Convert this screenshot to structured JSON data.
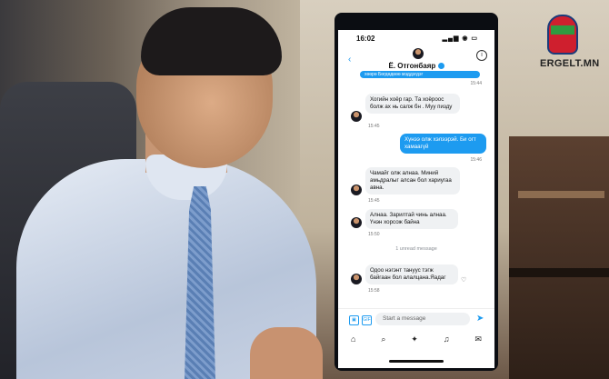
{
  "brand": {
    "name": "ERGELT.MN"
  },
  "status_bar": {
    "time": "16:02",
    "icons": "▂▄▆ ◉ ▭"
  },
  "header": {
    "back": "‹",
    "contact_name": "Ё. Отгонбаяр",
    "info": "i",
    "clipped_line": "хөөрө Бөгдөдөөө мэддэгдэг"
  },
  "messages": [
    {
      "dir": "in",
      "text": "",
      "time": "15:44"
    },
    {
      "dir": "in",
      "text": "Хогийн хоёр гар. Та хоёроос болж ах нь салж бн . Муу пизду",
      "time": "15:45"
    },
    {
      "dir": "out",
      "text": "Хүнээ олж хэлээрэй. Би огт хамаагүй",
      "time": "15:46"
    },
    {
      "dir": "in",
      "text": "Чамайг олж алнаа. Миний амьдралыг алсан бол хариугаа авна.",
      "time": "15:45"
    },
    {
      "dir": "in",
      "text": "Алнаа. Зарилтай чинь алнаа. Үнэн хорсож байна",
      "time": "15:50"
    },
    {
      "dir": "in",
      "text": "Одоо нэгэнт тануус тэгж байгаан бол алалцана.Яадаг",
      "time": "15:58"
    }
  ],
  "unread_label": "1 unread message",
  "composer": {
    "placeholder": "Start a message",
    "gif": "GIF",
    "media": "▣"
  },
  "bottom_nav": [
    "⌂",
    "⌕",
    "✦",
    "♫",
    "✉"
  ]
}
